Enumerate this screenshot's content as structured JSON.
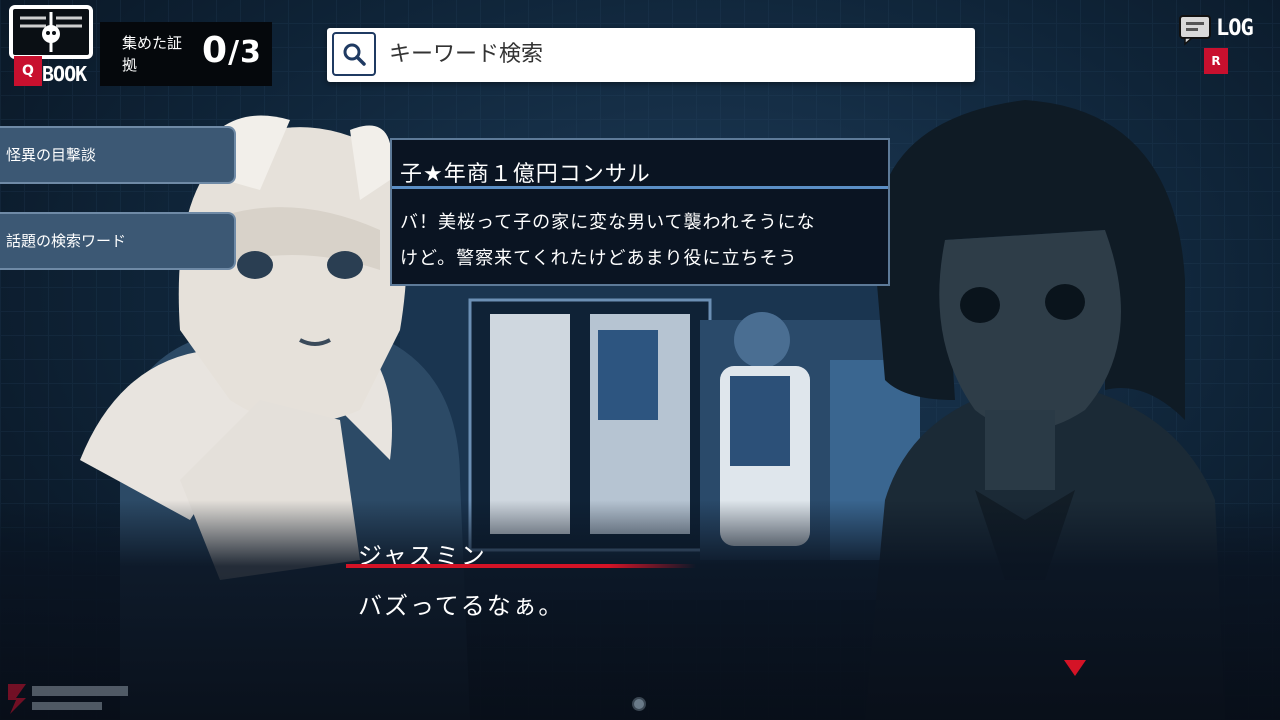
{
  "hud": {
    "book": {
      "key": "Q",
      "label": "BOOK"
    },
    "evidence": {
      "label": "集めた証拠",
      "collected": "0",
      "total": "/3"
    },
    "log": {
      "label": "LOG",
      "key": "R"
    }
  },
  "search": {
    "placeholder": "キーワード検索"
  },
  "side_tabs": [
    {
      "label": "怪異の目撃談"
    },
    {
      "label": "話題の検索ワード"
    }
  ],
  "post": {
    "title": "子★年商１億円コンサル",
    "lines": [
      "バ！美桜って子の家に変な男いて襲われそうにな",
      "けど。警察来てくれたけどあまり役に立ちそう"
    ]
  },
  "dialogue": {
    "speaker": "ジャスミン",
    "text": "バズってるなぁ。"
  },
  "colors": {
    "accent": "#d41326",
    "panel": "#0a1422",
    "tab": "#3c5874"
  },
  "icons": [
    "book-icon",
    "search-icon",
    "log-icon",
    "advance-arrow-icon"
  ]
}
